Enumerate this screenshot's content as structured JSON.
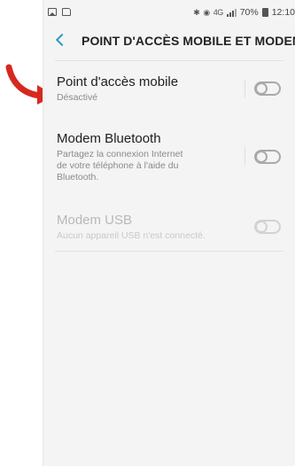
{
  "status_bar": {
    "signal_text": "4G",
    "battery_percent": "70%",
    "time": "12:10"
  },
  "header": {
    "title": "POINT D'ACCÈS MOBILE ET MODEM"
  },
  "settings": [
    {
      "title": "Point d'accès mobile",
      "subtitle": "Désactivé",
      "enabled": false,
      "disabled": false
    },
    {
      "title": "Modem Bluetooth",
      "subtitle_lines": [
        "Partagez la connexion Internet",
        "de votre téléphone à l'aide du",
        "Bluetooth."
      ],
      "enabled": false,
      "disabled": false
    },
    {
      "title": "Modem USB",
      "subtitle": "Aucun appareil USB n'est connecté.",
      "enabled": false,
      "disabled": true
    }
  ],
  "colors": {
    "accent": "#2b9ac4",
    "arrow": "#d7281e",
    "background": "#f4f4f4"
  }
}
